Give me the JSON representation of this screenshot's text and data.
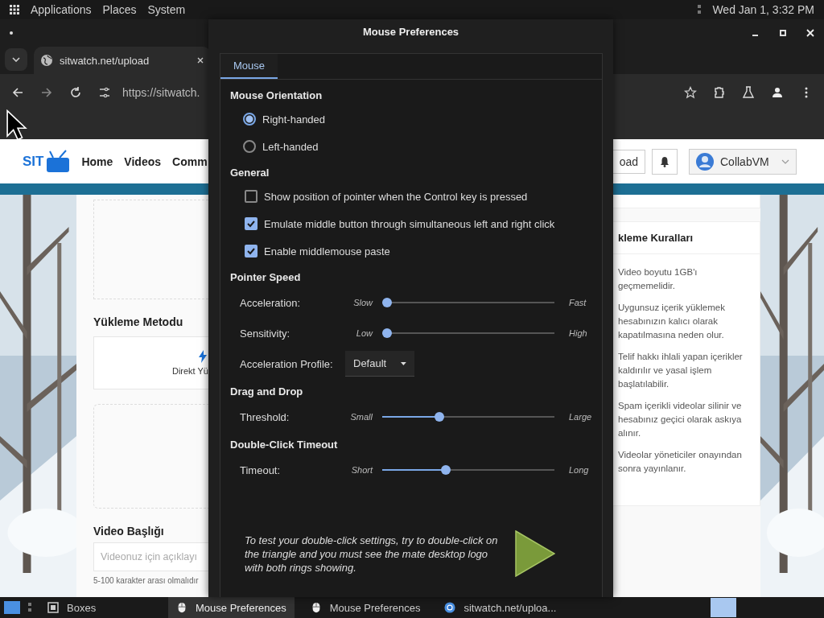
{
  "top_panel": {
    "menus": [
      "Applications",
      "Places",
      "System"
    ],
    "clock": "Wed Jan 1, 3:32 PM"
  },
  "browser": {
    "tab": {
      "title": "sitwatch.net/upload"
    },
    "url": "https://sitwatch.",
    "page": {
      "logo_text": "SIT",
      "nav": [
        "Home",
        "Videos",
        "Comm"
      ],
      "upload_button": "oad",
      "user": "CollabVM",
      "upload_method": {
        "heading": "Yükleme Metodu",
        "option": "Direkt Yü"
      },
      "title_field": {
        "label": "Video Başlığı",
        "placeholder": "Videonuz için açıklayı",
        "hint": "5-100 karakter arası olmalıdır"
      },
      "rules": {
        "heading": "kleme Kuralları",
        "items": [
          "Video boyutu 1GB'ı geçmemelidir.",
          "Uygunsuz içerik yüklemek hesabınızın kalıcı olarak kapatılmasına neden olur.",
          "Telif hakkı ihlali yapan içerikler kaldırılır ve yasal işlem başlatılabilir.",
          "Spam içerikli videolar silinir ve hesabınız geçici olarak askıya alınır.",
          "Videolar yöneticiler onayından sonra yayınlanır."
        ]
      }
    }
  },
  "dialog": {
    "title": "Mouse Preferences",
    "tabs": [
      {
        "label": "Mouse",
        "selected": true
      }
    ],
    "sections": [
      {
        "heading": "Mouse Orientation",
        "rows": [
          {
            "kind": "radio",
            "label": "Right-handed",
            "selected": true
          },
          {
            "kind": "radio",
            "label": "Left-handed",
            "selected": false
          }
        ]
      },
      {
        "heading": "General",
        "rows": [
          {
            "kind": "check",
            "label": "Show position of pointer when the Control key is pressed",
            "checked": false
          },
          {
            "kind": "check",
            "label": "Emulate middle button through simultaneous left and right click",
            "checked": true
          },
          {
            "kind": "check",
            "label": "Enable middlemouse paste",
            "checked": true
          }
        ]
      },
      {
        "heading": "Pointer Speed",
        "rows": [
          {
            "kind": "slider",
            "label": "Acceleration:",
            "min": "Slow",
            "max": "Fast",
            "level": 0
          },
          {
            "kind": "slider",
            "label": "Sensitivity:",
            "min": "Low",
            "max": "High",
            "level": 0
          },
          {
            "kind": "combo",
            "label": "Acceleration Profile:",
            "value": "Default"
          }
        ]
      },
      {
        "heading": "Drag and Drop",
        "rows": [
          {
            "kind": "slider",
            "label": "Threshold:",
            "min": "Small",
            "max": "Large",
            "level": 0.32
          }
        ]
      },
      {
        "heading": "Double-Click Timeout",
        "rows": [
          {
            "kind": "slider",
            "label": "Timeout:",
            "min": "Short",
            "max": "Long",
            "level": 0.36
          }
        ]
      }
    ],
    "note": "To test your double-click settings, try to double-click on the triangle and you must see the mate desktop logo with both rings showing."
  },
  "taskbar": {
    "items": [
      {
        "label": "Boxes",
        "kind": "boxes",
        "selected": false
      },
      {
        "label": "Mouse Preferences",
        "kind": "mouse",
        "selected": true
      },
      {
        "label": "Mouse Preferences",
        "kind": "mouse",
        "selected": false
      },
      {
        "label": "sitwatch.net/uploa...",
        "kind": "browser",
        "selected": false
      }
    ]
  }
}
